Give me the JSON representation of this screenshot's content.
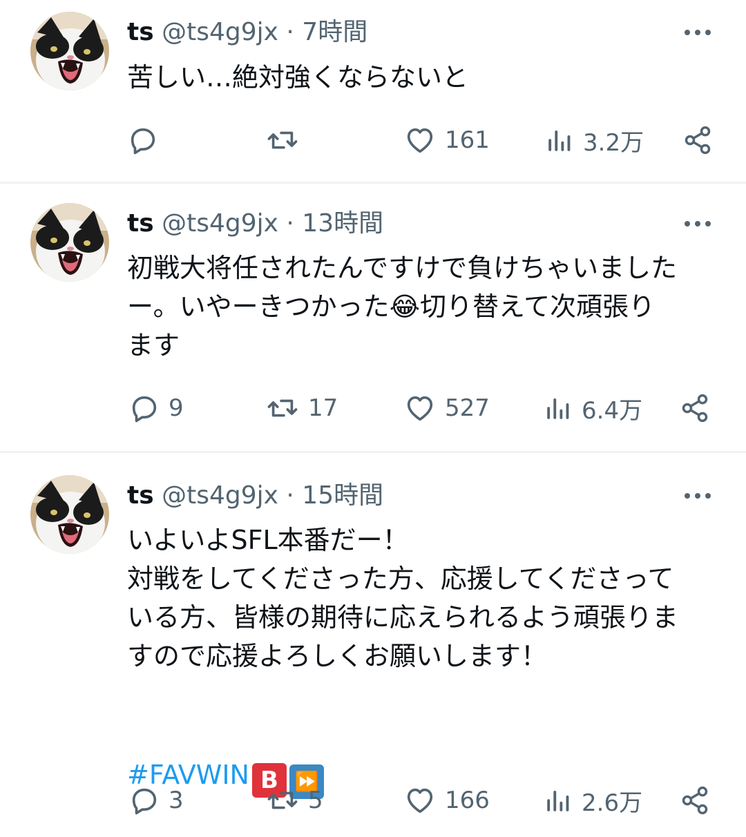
{
  "tweets": [
    {
      "name": "ts",
      "handle": "@ts4g9jx",
      "separator": "·",
      "time": "7時間",
      "text": "苦しい…絶対強くならないと",
      "actions": {
        "reply": "",
        "retweet": "",
        "like": "161",
        "views": "3.2万"
      }
    },
    {
      "name": "ts",
      "handle": "@ts4g9jx",
      "separator": "·",
      "time": "13時間",
      "text_before_emoji": "初戦大将任されたんですけで負けちゃいました\nー。いやーきつかった",
      "emoji": "😂",
      "text_after_emoji": "切り替えて次頑張り\nます",
      "actions": {
        "reply": "9",
        "retweet": "17",
        "like": "527",
        "views": "6.4万"
      }
    },
    {
      "name": "ts",
      "handle": "@ts4g9jx",
      "separator": "·",
      "time": "15時間",
      "text": "いよいよSFL本番だー！\n対戦をしてくださった方、応援してくださって\nいる方、皆様の期待に応えられるよう頑張りま\nすので応援よろしくお願いします！",
      "hashtag": "#FAVWIN",
      "badge_b": "B",
      "badge_ff": "⏩",
      "actions": {
        "reply": "3",
        "retweet": "5",
        "like": "166",
        "views": "2.6万"
      }
    }
  ],
  "colors": {
    "text": "#0f1419",
    "secondary": "#536471",
    "link": "#1d9bf0",
    "divider": "#eff3f4",
    "badge_red": "#e0323a",
    "badge_blue": "#3b88c3"
  },
  "icons": {
    "avatar": "cat-avatar",
    "more": "more-horizontal-icon",
    "reply": "reply-bubble-icon",
    "retweet": "retweet-icon",
    "like": "heart-icon",
    "views": "views-bar-chart-icon",
    "share": "share-icon"
  }
}
